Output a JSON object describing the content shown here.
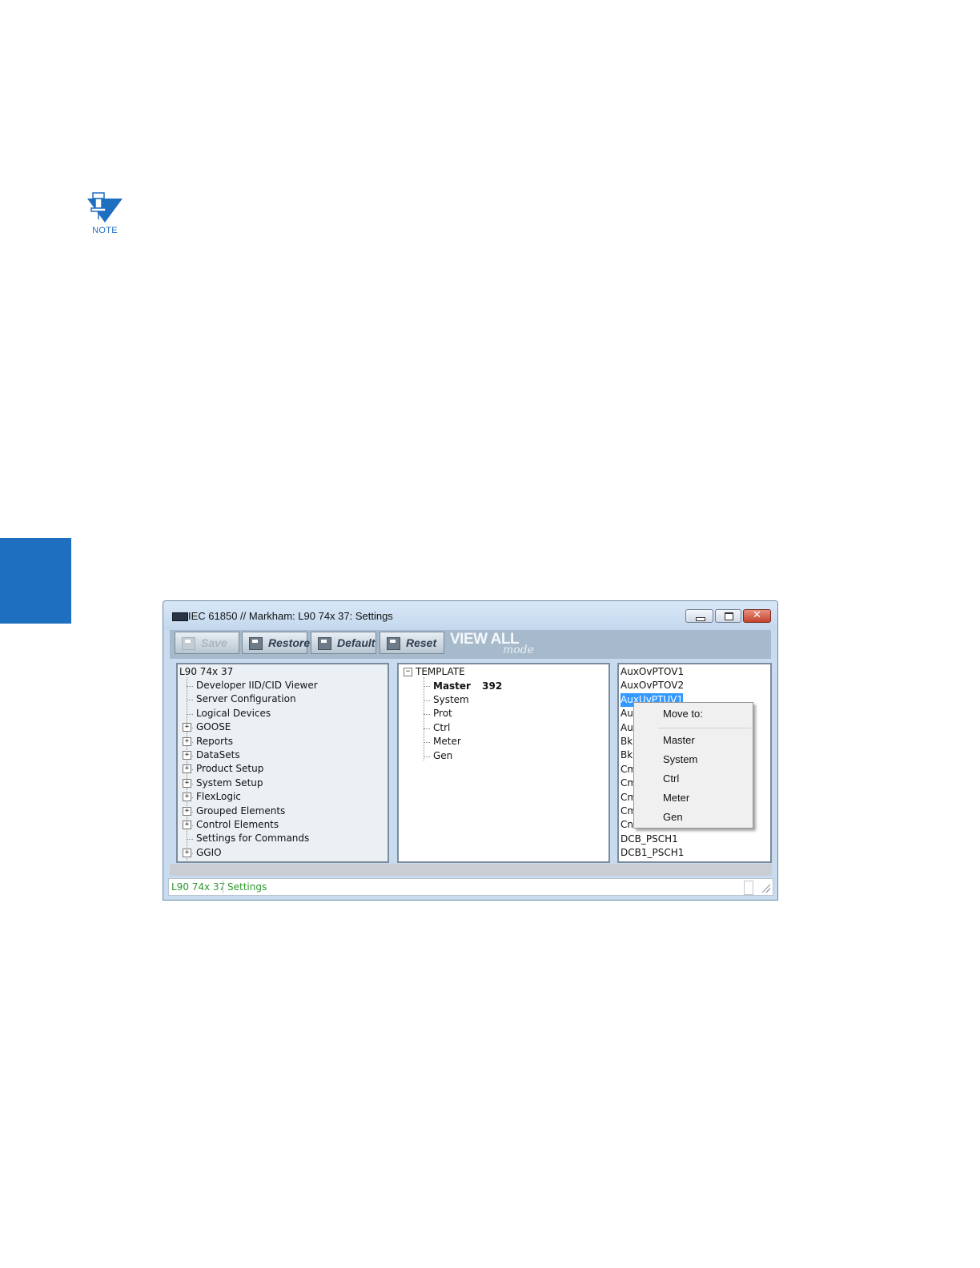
{
  "note": {
    "label": "NOTE"
  },
  "window": {
    "title": "IEC 61850 // Markham: L90 74x 37: Settings",
    "close_glyph": "✕"
  },
  "toolbar": {
    "save": "Save",
    "restore": "Restore",
    "default": "Default",
    "reset": "Reset",
    "view_all": "VIEW ALL",
    "mode": "mode"
  },
  "tree": {
    "root": "L90 74x 37",
    "items": [
      {
        "label": "Developer IID/CID Viewer",
        "expandable": false
      },
      {
        "label": "Server Configuration",
        "expandable": false
      },
      {
        "label": "Logical Devices",
        "expandable": false
      },
      {
        "label": "GOOSE",
        "expandable": true
      },
      {
        "label": "Reports",
        "expandable": true
      },
      {
        "label": "DataSets",
        "expandable": true
      },
      {
        "label": "Product Setup",
        "expandable": true
      },
      {
        "label": "System Setup",
        "expandable": true
      },
      {
        "label": "FlexLogic",
        "expandable": true
      },
      {
        "label": "Grouped Elements",
        "expandable": true
      },
      {
        "label": "Control Elements",
        "expandable": true
      },
      {
        "label": "Settings for Commands",
        "expandable": false
      },
      {
        "label": "GGIO",
        "expandable": true
      }
    ]
  },
  "template": {
    "root": "TEMPLATE",
    "collapse_glyph": "−",
    "master": "Master",
    "master_count": "392",
    "items": [
      "System",
      "Prot",
      "Ctrl",
      "Meter",
      "Gen"
    ]
  },
  "nodes": {
    "items": [
      "AuxOvPTOV1",
      "AuxOvPTOV2",
      "AuxUvPTUV1",
      "Au",
      "Au",
      "Bkr",
      "Bkr",
      "Cm",
      "Cm",
      "Cm",
      "Cm",
      "Cn",
      "DCB_PSCH1",
      "DCB1_PSCH1"
    ],
    "selected_index": 2
  },
  "context_menu": {
    "header": "Move to:",
    "items": [
      "Master",
      "System",
      "Ctrl",
      "Meter",
      "Gen"
    ]
  },
  "status": {
    "device": "L90 74x 37",
    "mode": "Settings"
  }
}
